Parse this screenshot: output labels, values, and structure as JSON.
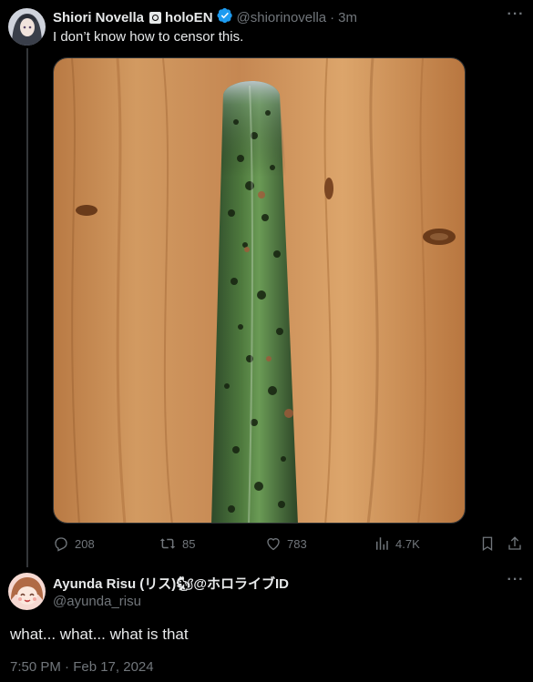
{
  "post": {
    "display_name": "Shiori Novella",
    "affiliation": "holoEN",
    "handle": "@shiorinovella",
    "time_ago": "3m",
    "text": "I don’t know how to censor this.",
    "stats": {
      "replies": "208",
      "reposts": "85",
      "likes": "783",
      "views": "4.7K"
    }
  },
  "reply": {
    "display_name": "Ayunda Risu (リス)🐿@ホロライブID",
    "handle": "@ayunda_risu",
    "text": "what... what... what is that",
    "timestamp": "7:50 PM · Feb 17, 2024"
  },
  "colors": {
    "background": "#000000",
    "text_primary": "#e7e9ea",
    "text_secondary": "#71767b",
    "verified": "#1d9bf0",
    "divider": "#333639"
  },
  "icons": {
    "more": "more-icon",
    "verified": "verified-badge-icon",
    "reply": "reply-icon",
    "repost": "repost-icon",
    "like": "like-icon",
    "views": "views-icon",
    "bookmark": "bookmark-icon",
    "share": "share-icon"
  }
}
